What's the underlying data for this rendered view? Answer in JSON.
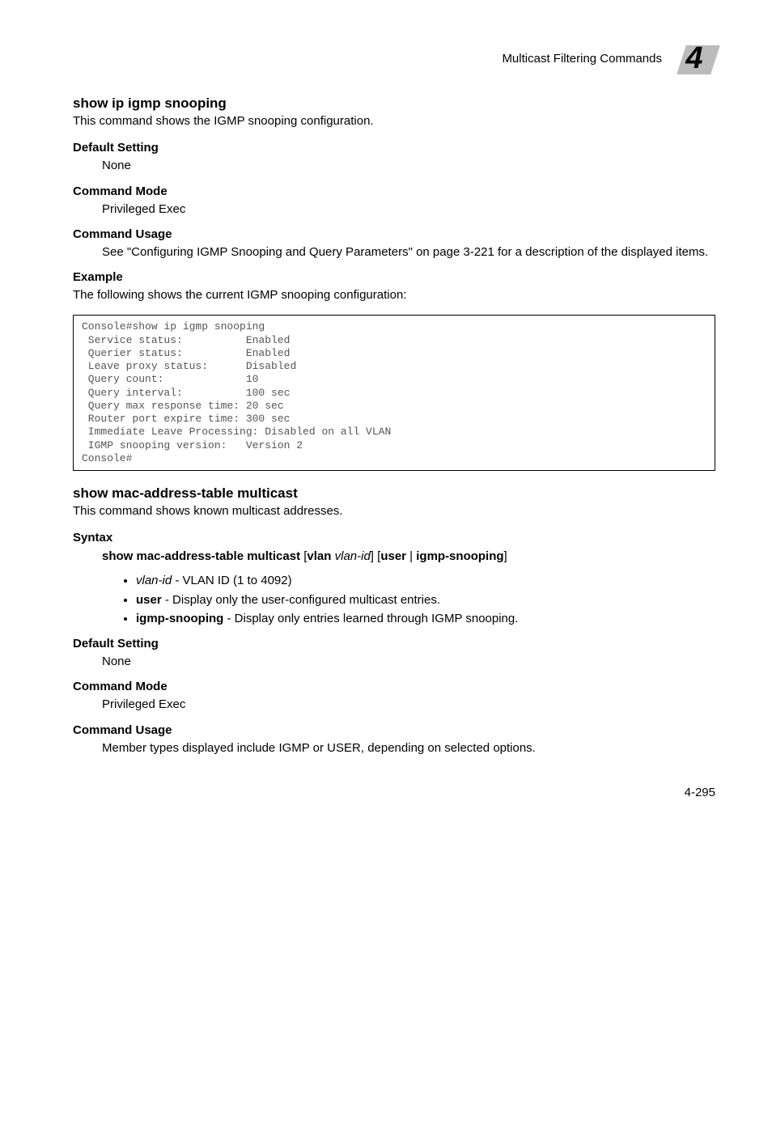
{
  "header": {
    "section_title": "Multicast Filtering Commands",
    "chapter_number": "4"
  },
  "sections": [
    {
      "title": "show ip igmp snooping",
      "intro": "This command shows the IGMP snooping configuration.",
      "blocks": [
        {
          "heading": "Default Setting",
          "text": "None"
        },
        {
          "heading": "Command Mode",
          "text": "Privileged Exec"
        },
        {
          "heading": "Command Usage",
          "text": "See \"Configuring IGMP Snooping and Query Parameters\" on page 3-221 for a description of the displayed items."
        }
      ],
      "example_heading": "Example",
      "example_intro": "The following shows the current IGMP snooping configuration:",
      "code": "Console#show ip igmp snooping\n Service status:          Enabled\n Querier status:          Enabled\n Leave proxy status:      Disabled\n Query count:             10\n Query interval:          100 sec\n Query max response time: 20 sec\n Router port expire time: 300 sec\n Immediate Leave Processing: Disabled on all VLAN\n IGMP snooping version:   Version 2\nConsole#"
    },
    {
      "title": "show mac-address-table multicast",
      "intro": "This command shows known multicast addresses.",
      "syntax_heading": "Syntax",
      "syntax_line_parts": {
        "cmd": "show mac-address-table multicast",
        "lb1": "[",
        "kw_vlan": "vlan",
        "sp1": " ",
        "arg_vlan": "vlan-id",
        "rb1": "] [",
        "kw_user": "user",
        "pipe": " | ",
        "kw_igmp": "igmp-snooping",
        "rb2": "]"
      },
      "bullets": [
        {
          "term_italic": "vlan-id",
          "dash": " - ",
          "desc": "VLAN ID (1 to 4092)"
        },
        {
          "term_bold": "user",
          "dash": " - ",
          "desc": "Display only the user-configured multicast entries."
        },
        {
          "term_bold": "igmp-snooping",
          "dash": " - ",
          "desc": "Display only entries learned through IGMP snooping."
        }
      ],
      "blocks": [
        {
          "heading": "Default Setting",
          "text": "None"
        },
        {
          "heading": "Command Mode",
          "text": "Privileged Exec"
        },
        {
          "heading": "Command Usage",
          "text": "Member types displayed include IGMP or USER, depending on selected options."
        }
      ]
    }
  ],
  "footer": {
    "page_number": "4-295"
  }
}
